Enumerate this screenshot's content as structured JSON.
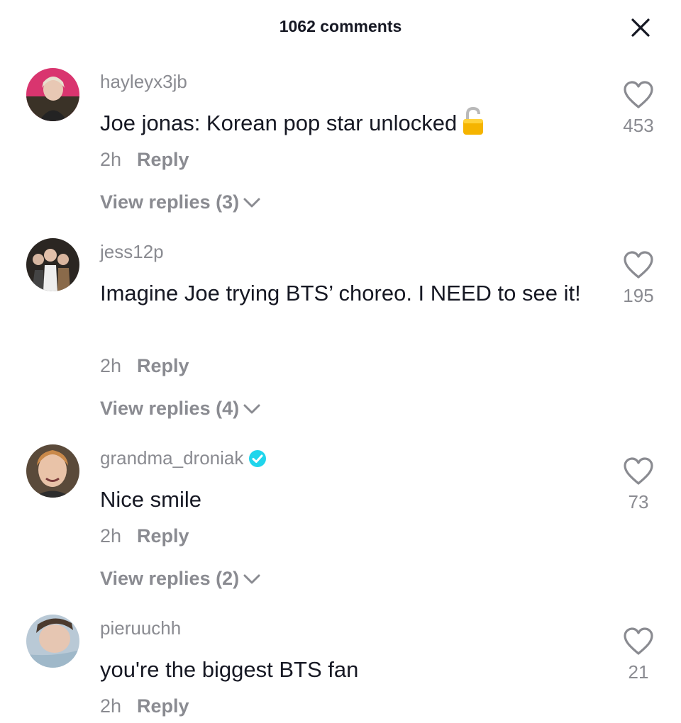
{
  "header": {
    "title": "1062 comments"
  },
  "comments": [
    {
      "username": "hayleyx3jb",
      "text": "Joe jonas: Korean pop star unlocked",
      "time": "2h",
      "reply_label": "Reply",
      "view_replies": "View replies (3)",
      "likes": "453"
    },
    {
      "username": "jess12p",
      "text": "Imagine Joe trying BTS’ choreo. I NEED to see it!",
      "time": "2h",
      "reply_label": "Reply",
      "view_replies": "View replies (4)",
      "likes": "195"
    },
    {
      "username": "grandma_droniak",
      "verified": true,
      "text": "Nice smile",
      "time": "2h",
      "reply_label": "Reply",
      "view_replies": "View replies (2)",
      "likes": "73"
    },
    {
      "username": "pieruuchh",
      "text": "you're the biggest BTS fan",
      "time": "2h",
      "reply_label": "Reply",
      "likes": "21"
    }
  ],
  "icons": {
    "close": "close-icon",
    "like": "heart-outline-icon",
    "verified": "verified-badge-icon",
    "lock": "unlocked-padlock-emoji",
    "chevron": "chevron-down-icon"
  },
  "colors": {
    "primary_text": "#161823",
    "secondary_text": "#8a8b91",
    "verified": "#20d5ec"
  }
}
